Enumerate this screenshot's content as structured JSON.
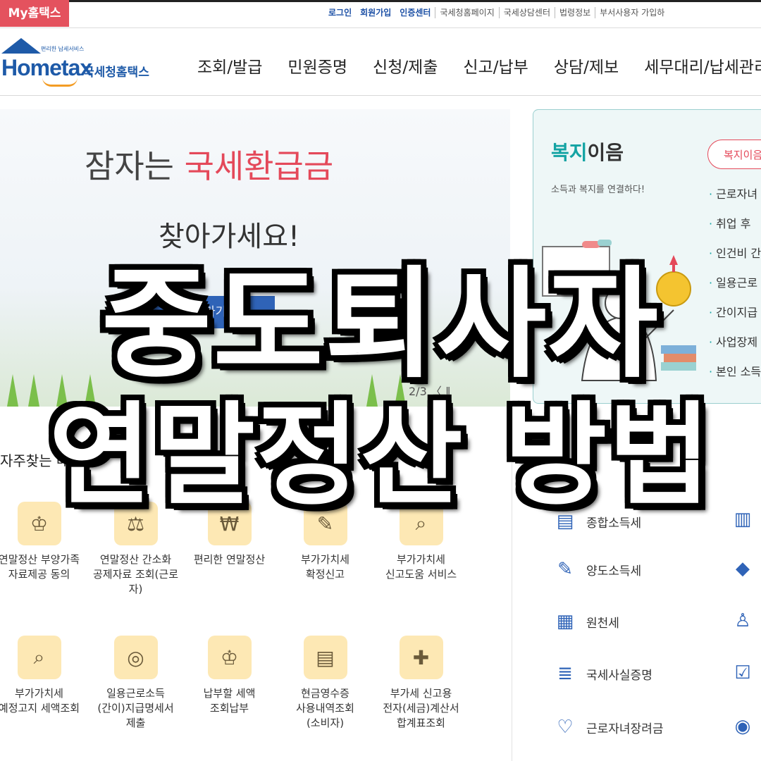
{
  "topbar": {
    "my_tab": "My홈택스",
    "links": [
      "로그인",
      "회원가입",
      "인증센터",
      "국세청홈페이지",
      "국세상담센터",
      "법령정보",
      "부서사용자 가입하"
    ]
  },
  "logo": {
    "text": "Hometax",
    "kr": "국세청홈택스",
    "sub": "편리한 납세서비스"
  },
  "nav": [
    "조회/발급",
    "민원증명",
    "신청/제출",
    "신고/납부",
    "상담/제보",
    "세무대리/납세관리"
  ],
  "banner": {
    "line1_pre": "잠자는 ",
    "line1_highlight": "국세환급금",
    "line2": "찾아가세요!",
    "button": "바로가기",
    "pager": "2/3 〈 ‖"
  },
  "welfare": {
    "title_highlight": "복지",
    "title_rest": "이음",
    "subtitle": "소득과 복지를 연결하다!",
    "button": "복지이음",
    "items": [
      "근로자녀",
      "취업 후",
      "인건비 간",
      "일용근로",
      "간이지급",
      "사업장제",
      "본인 소득"
    ]
  },
  "favorites": {
    "title": "자주찾는 메뉴",
    "items": [
      {
        "label": "연말정산 부양가족\n자료제공 동의",
        "icon": "money-bag-icon"
      },
      {
        "label": "연말정산 간소화\n공제자료 조회(근로\n자)",
        "icon": "coin-bag-icon"
      },
      {
        "label": "편리한 연말정산",
        "icon": "document-won-icon"
      },
      {
        "label": "부가가치세\n확정신고",
        "icon": "vat-pen-icon"
      },
      {
        "label": "부가가치세\n신고도움 서비스",
        "icon": "document-search-icon"
      },
      {
        "label": "부가가치세\n예정고지 세액조회",
        "icon": "document-magnifier-icon"
      },
      {
        "label": "일용근로소득\n(간이)지급명세서\n제출",
        "icon": "coin-icon"
      },
      {
        "label": "납부할 세액\n조회납부",
        "icon": "money-bag-icon"
      },
      {
        "label": "현금영수증\n사용내역조회\n(소비자)",
        "icon": "receipt-icon"
      },
      {
        "label": "부가세 신고용\n전자(세금)계산서\n합계표조회",
        "icon": "document-plus-icon"
      }
    ]
  },
  "tax_menu": [
    {
      "label": "종합소득세",
      "icon": "tax-doc-icon"
    },
    {
      "label": "양도소득세",
      "icon": "transfer-doc-icon"
    },
    {
      "label": "원천세",
      "icon": "withholding-doc-icon"
    },
    {
      "label": "국세사실증명",
      "icon": "certificate-icon"
    },
    {
      "label": "근로자녀장려금",
      "icon": "heart-hand-icon"
    }
  ],
  "right_icons": [
    "building-icon",
    "diamond-icon",
    "person-icon",
    "clipboard-check-icon",
    "coin-chat-icon"
  ],
  "overlay": {
    "line1": "중도퇴사자",
    "line2": "연말정산 방법"
  },
  "colors": {
    "brand_blue": "#1e5aa8",
    "accent_red": "#e4495a",
    "teal": "#13a3a3",
    "icon_bg": "#fde8b4"
  }
}
